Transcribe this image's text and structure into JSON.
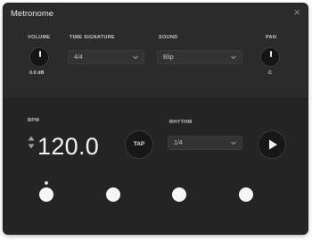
{
  "window": {
    "title": "Metronome",
    "close_glyph": "×"
  },
  "volume": {
    "label": "VOLUME",
    "value": "0.0 dB"
  },
  "time_signature": {
    "label": "TIME SIGNATURE",
    "value": "4/4"
  },
  "sound": {
    "label": "SOUND",
    "value": "Blip"
  },
  "pan": {
    "label": "PAN",
    "value": "C"
  },
  "bpm": {
    "label": "BPM",
    "value": "120.0"
  },
  "tap": {
    "label": "TAP"
  },
  "rhythm": {
    "label": "RHYTHM",
    "value": "1/4"
  },
  "beats": {
    "count": 4,
    "current": 1
  },
  "icons": {
    "close": "close-icon",
    "chevron": "chevron-down-icon",
    "bpm_up": "triangle-up-icon",
    "bpm_down": "triangle-down-icon",
    "play": "play-icon"
  },
  "colors": {
    "window_bg": "#2b2b2b",
    "lower_panel_bg": "#242424",
    "control_bg": "#171717",
    "text_primary": "#f2f2f2",
    "beat_light": "#f5f5f5"
  }
}
